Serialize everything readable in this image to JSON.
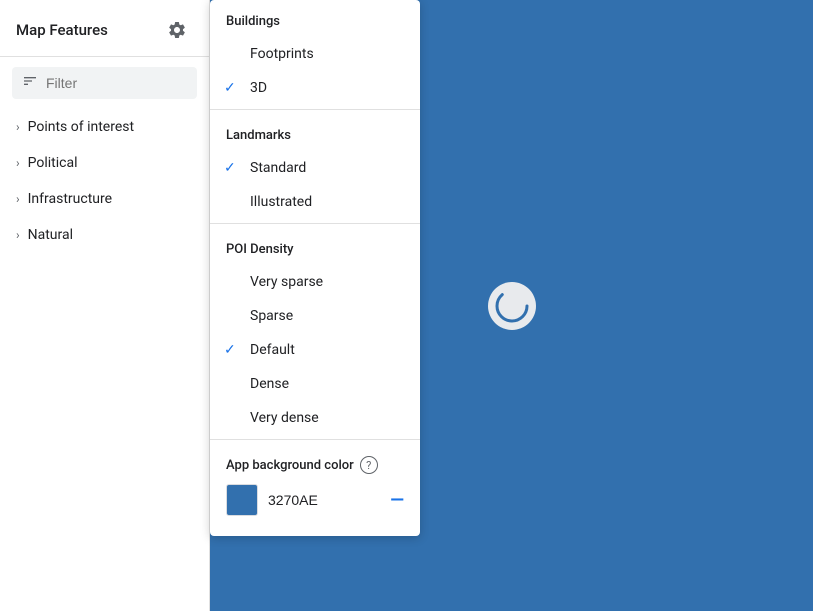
{
  "sidebar": {
    "title": "Map Features",
    "filter_placeholder": "Filter",
    "nav_items": [
      {
        "label": "Points of interest"
      },
      {
        "label": "Political"
      },
      {
        "label": "Infrastructure"
      },
      {
        "label": "Natural"
      }
    ]
  },
  "dropdown": {
    "sections": [
      {
        "id": "buildings",
        "header": "Buildings",
        "items": [
          {
            "label": "Footprints",
            "checked": false
          },
          {
            "label": "3D",
            "checked": true
          }
        ]
      },
      {
        "id": "landmarks",
        "header": "Landmarks",
        "items": [
          {
            "label": "Standard",
            "checked": true
          },
          {
            "label": "Illustrated",
            "checked": false
          }
        ]
      },
      {
        "id": "poi_density",
        "header": "POI Density",
        "items": [
          {
            "label": "Very sparse",
            "checked": false
          },
          {
            "label": "Sparse",
            "checked": false
          },
          {
            "label": "Default",
            "checked": true
          },
          {
            "label": "Dense",
            "checked": false
          },
          {
            "label": "Very dense",
            "checked": false
          }
        ]
      }
    ],
    "color_section": {
      "label": "App background color",
      "value": "3270AE",
      "color_hex": "#3270ae",
      "minus_label": "—"
    }
  },
  "map": {
    "background_color": "#3270ae",
    "spinner_letter": "C"
  },
  "icons": {
    "gear": "⚙",
    "filter_lines": "≡",
    "chevron": "›",
    "checkmark": "✓",
    "help": "?",
    "minus": "—"
  }
}
